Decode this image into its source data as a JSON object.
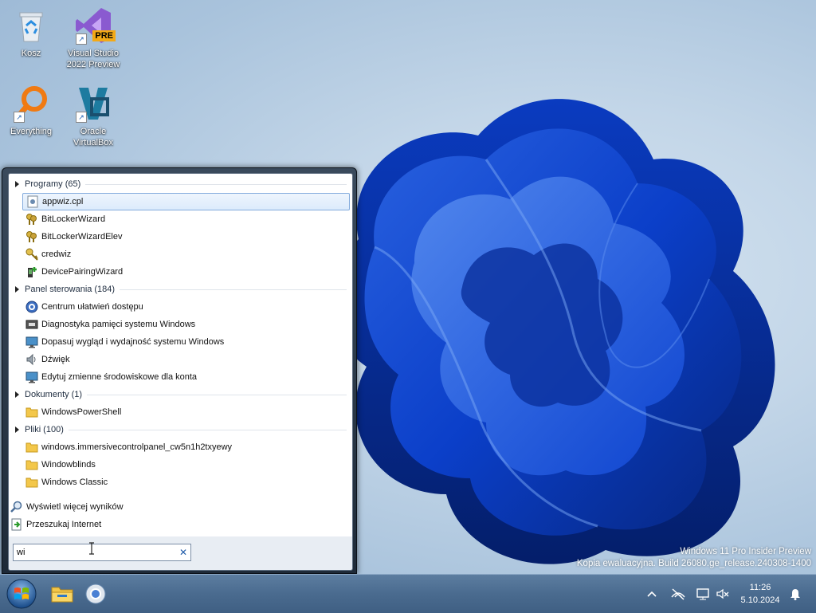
{
  "desktop": {
    "icons": [
      {
        "label": "Kosz",
        "icon": "recycle-bin-icon"
      },
      {
        "label": "Visual Studio 2022 Preview",
        "icon": "visual-studio-icon",
        "badge": "PRE"
      },
      {
        "label": "Everything",
        "icon": "everything-search-icon"
      },
      {
        "label": "Oracle VirtualBox",
        "icon": "virtualbox-icon"
      }
    ],
    "watermark": {
      "line1": "Windows 11 Pro Insider Preview",
      "line2": "Kopia ewaluacyjna. Build 26080.ge_release.240308-1400"
    }
  },
  "start_menu": {
    "groups": [
      {
        "name": "Programy",
        "count": "(65)",
        "items": [
          {
            "label": "appwiz.cpl",
            "icon": "control-panel-applet-icon",
            "selected": true
          },
          {
            "label": "BitLockerWizard",
            "icon": "keys-icon"
          },
          {
            "label": "BitLockerWizardElev",
            "icon": "keys-icon"
          },
          {
            "label": "credwiz",
            "icon": "key-icon"
          },
          {
            "label": "DevicePairingWizard",
            "icon": "device-pairing-icon"
          }
        ]
      },
      {
        "name": "Panel sterowania",
        "count": "(184)",
        "items": [
          {
            "label": "Centrum ułatwień dostępu",
            "icon": "accessibility-icon"
          },
          {
            "label": "Diagnostyka pamięci systemu Windows",
            "icon": "memory-chip-icon"
          },
          {
            "label": "Dopasuj wygląd i wydajność systemu Windows",
            "icon": "monitor-icon"
          },
          {
            "label": "Dźwięk",
            "icon": "speaker-icon"
          },
          {
            "label": "Edytuj zmienne środowiskowe dla konta",
            "icon": "monitor-icon"
          }
        ]
      },
      {
        "name": "Dokumenty",
        "count": "(1)",
        "items": [
          {
            "label": "WindowsPowerShell",
            "icon": "folder-icon"
          }
        ]
      },
      {
        "name": "Pliki",
        "count": "(100)",
        "items": [
          {
            "label": "windows.immersivecontrolpanel_cw5n1h2txyewy",
            "icon": "folder-icon"
          },
          {
            "label": "Windowblinds",
            "icon": "folder-icon"
          },
          {
            "label": "Windows Classic",
            "icon": "folder-icon"
          }
        ]
      }
    ],
    "more_results": "Wyświetl więcej wyników",
    "search_internet": "Przeszukaj Internet",
    "search": {
      "value": "wi",
      "clear_icon": "close-icon"
    }
  },
  "taskbar": {
    "start_icon": "windows-orb-icon",
    "pinned": [
      {
        "name": "file-explorer",
        "icon": "folder-icon"
      },
      {
        "name": "chrome",
        "icon": "chrome-icon"
      }
    ],
    "tray": {
      "icons": [
        "chevron-up-icon",
        "network-disconnected-icon",
        "display-icon",
        "volume-muted-icon"
      ],
      "time": "11:26",
      "date": "5.10.2024",
      "notification_icon": "bell-icon"
    }
  }
}
